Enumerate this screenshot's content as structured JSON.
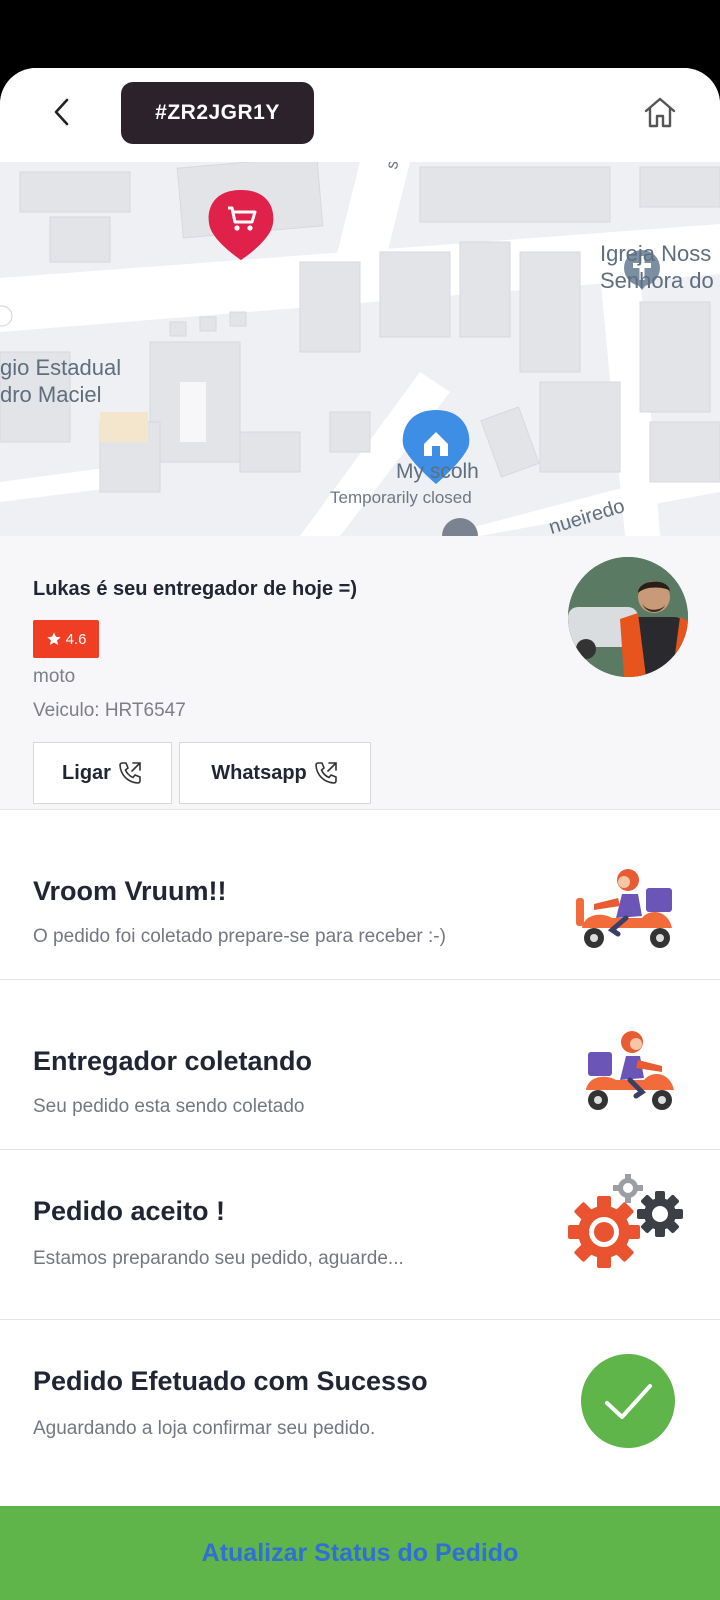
{
  "header": {
    "order_code": "#ZR2JGR1Y"
  },
  "map": {
    "labels": {
      "church": "Igreja Noss\nSenhora do",
      "school": "gio Estadual\ndro Maciel",
      "place": "My scolh",
      "place_status": "Temporarily closed",
      "street_top": "sns",
      "street_bottom": "nueiredo"
    }
  },
  "courier": {
    "title": "Lukas é seu entregador de hoje =)",
    "rating": "4.6",
    "vehicle_type": "moto",
    "vehicle_plate": "Veiculo: HRT6547",
    "call_label": "Ligar",
    "whatsapp_label": "Whatsapp"
  },
  "steps": [
    {
      "title": "Vroom Vruum!!",
      "desc": "O pedido foi coletado prepare-se para receber :-)",
      "icon": "scooter-delivery-icon"
    },
    {
      "title": "Entregador coletando",
      "desc": "Seu pedido esta sendo coletado",
      "icon": "scooter-pickup-icon"
    },
    {
      "title": "Pedido aceito !",
      "desc": "Estamos preparando seu pedido, aguarde...",
      "icon": "gears-icon"
    },
    {
      "title": "Pedido Efetuado com Sucesso",
      "desc": "Aguardando a loja confirmar seu pedido.",
      "icon": "check-circle-icon"
    }
  ],
  "footer": {
    "update_label": "Atualizar Status do Pedido"
  },
  "colors": {
    "primary_dark": "#2c222c",
    "rating_red": "#ef3e23",
    "success_green": "#5fb44a",
    "link_blue": "#2f6fd6",
    "store_pin": "#e0224a",
    "home_pin": "#3f8ee6"
  }
}
